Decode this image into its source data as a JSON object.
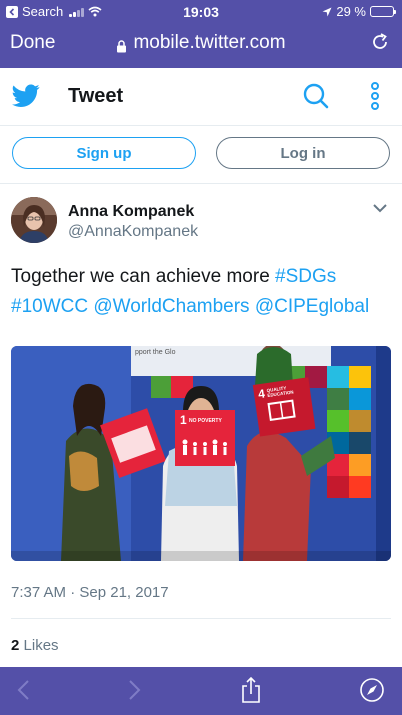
{
  "status_bar": {
    "back_app_label": "Search",
    "time": "19:03",
    "battery_text": "29 %",
    "battery_level": 0.29
  },
  "browser": {
    "done_label": "Done",
    "url": "mobile.twitter.com"
  },
  "twitter_header": {
    "title": "Tweet"
  },
  "auth": {
    "signup_label": "Sign up",
    "login_label": "Log in"
  },
  "tweet": {
    "author_name": "Anna Kompanek",
    "author_handle": "@AnnaKompanek",
    "text_plain": "Together we can achieve more ",
    "hashtag_sdgs": "#SDGs",
    "hashtag_10wcc": "#10WCC",
    "mention_worldchambers": "@WorldChambers",
    "mention_cipeglobal": "@CIPEglobal",
    "photo_labels": {
      "goal1_number": "1",
      "goal1_title": "NO POVERTY",
      "goal4_number": "4",
      "goal4_title": "QUALITY EDUCATION",
      "banner_fragment": "pport the Glo"
    },
    "timestamp": "7:37 AM · Sep 21, 2017",
    "likes_count": "2",
    "likes_label": "Likes"
  },
  "colors": {
    "browser_chrome": "#5450a8",
    "twitter_blue": "#1da1f2",
    "secondary_text": "#657786"
  },
  "icons": [
    "back-arrow-icon",
    "wifi-icon",
    "location-arrow-icon",
    "battery-icon",
    "lock-icon",
    "reload-icon",
    "twitter-bird-icon",
    "search-icon",
    "more-icon",
    "chevron-down-icon",
    "back-icon",
    "forward-icon",
    "share-icon",
    "compass-icon"
  ]
}
